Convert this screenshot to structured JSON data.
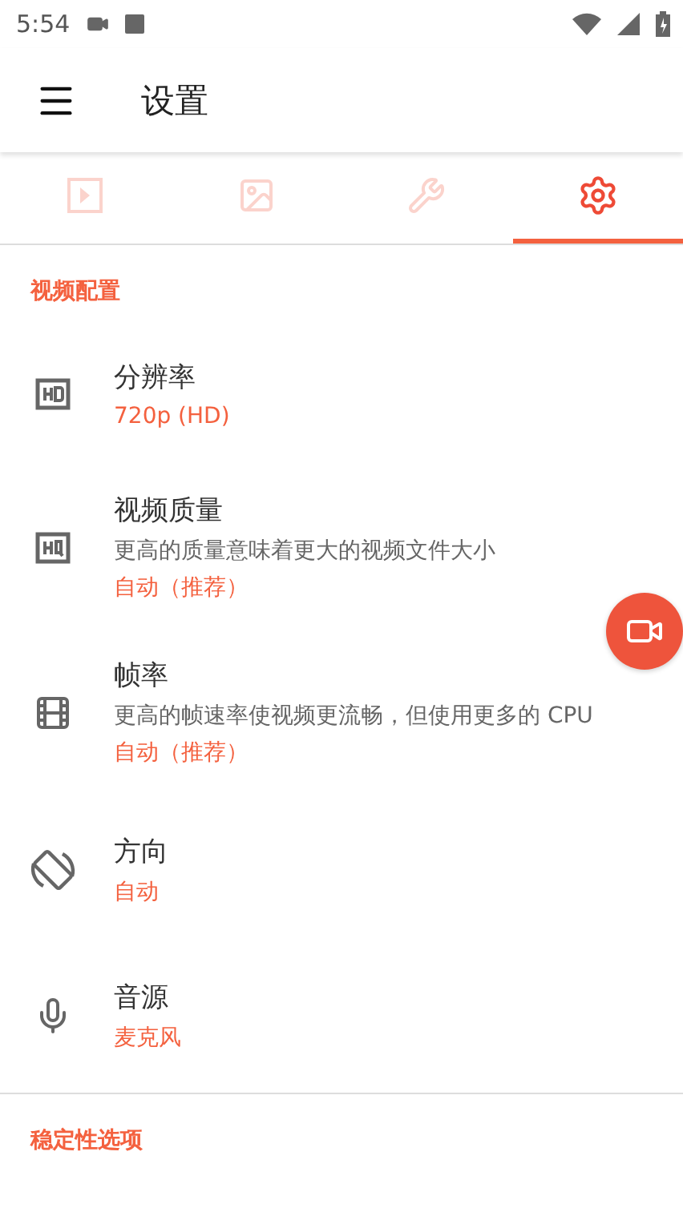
{
  "status_bar": {
    "time": "5:54"
  },
  "toolbar": {
    "title": "设置"
  },
  "tabs": [
    {
      "selected": false
    },
    {
      "selected": false
    },
    {
      "selected": false
    },
    {
      "selected": true
    }
  ],
  "sections": [
    {
      "title": "视频配置",
      "items": [
        {
          "title": "分辨率",
          "value": "720p (HD)"
        },
        {
          "title": "视频质量",
          "description": "更高的质量意味着更大的视频文件大小",
          "value": "自动（推荐）"
        },
        {
          "title": "帧率",
          "description": "更高的帧速率使视频更流畅，但使用更多的 CPU",
          "value": "自动（推荐）"
        },
        {
          "title": "方向",
          "value": "自动"
        },
        {
          "title": "音源",
          "value": "麦克风"
        }
      ]
    },
    {
      "title": "稳定性选项"
    }
  ]
}
